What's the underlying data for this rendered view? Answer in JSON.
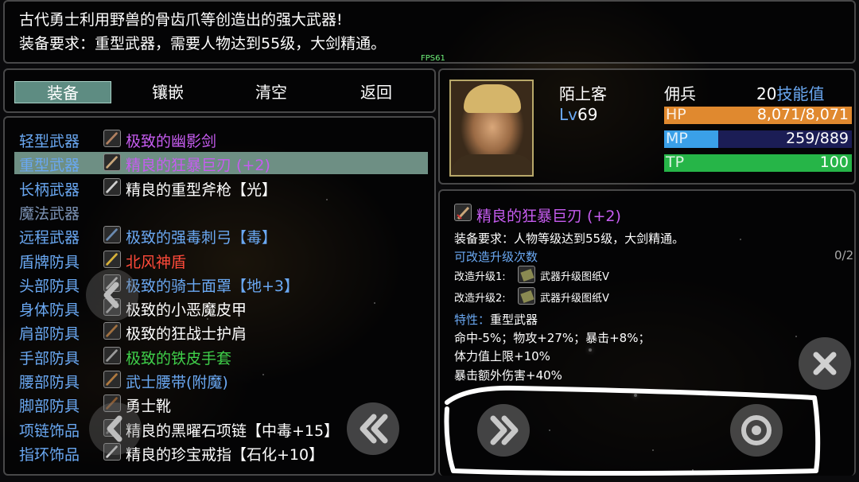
{
  "description": {
    "line1": "古代勇士利用野兽的骨齿爪等创造出的强大武器!",
    "line2": "装备要求：重型武器，需要人物达到55级，大剑精通。"
  },
  "fps": "FPS61",
  "tabs": [
    {
      "label": "装备",
      "active": true
    },
    {
      "label": "镶嵌",
      "active": false
    },
    {
      "label": "清空",
      "active": false
    },
    {
      "label": "返回",
      "active": false
    }
  ],
  "slots": [
    {
      "slot": "轻型武器",
      "item": "极致的幽影剑",
      "color": "#c65cf0",
      "icon": "sword-icon"
    },
    {
      "slot": "重型武器",
      "item": "精良的狂暴巨刃 (+2)",
      "color": "#c65cf0",
      "icon": "greatsword-icon",
      "selected": true
    },
    {
      "slot": "长柄武器",
      "item": "精良的重型斧枪【光】",
      "color": "#ffffff",
      "icon": "halberd-icon"
    },
    {
      "slot": "魔法武器",
      "item": "",
      "color": "#ffffff",
      "icon": "",
      "dim": true
    },
    {
      "slot": "远程武器",
      "item": "极致的强毒刺弓【毒】",
      "color": "#6aa8f2",
      "icon": "bow-icon"
    },
    {
      "slot": "盾牌防具",
      "item": "北风神盾",
      "color": "#ff4a3a",
      "icon": "shield-icon"
    },
    {
      "slot": "头部防具",
      "item": "极致的骑士面罩【地+3】",
      "color": "#6aa8f2",
      "icon": "helmet-icon"
    },
    {
      "slot": "身体防具",
      "item": "极致的小恶魔皮甲",
      "color": "#ffffff",
      "icon": "armor-icon"
    },
    {
      "slot": "肩部防具",
      "item": "极致的狂战士护肩",
      "color": "#ffffff",
      "icon": "pauldron-icon"
    },
    {
      "slot": "手部防具",
      "item": "极致的铁皮手套",
      "color": "#3fd04a",
      "icon": "gauntlet-icon"
    },
    {
      "slot": "腰部防具",
      "item": "武士腰带(附魔)",
      "color": "#6aa8f2",
      "icon": "belt-icon"
    },
    {
      "slot": "脚部防具",
      "item": "勇士靴",
      "color": "#ffffff",
      "icon": "boots-icon"
    },
    {
      "slot": "项链饰品",
      "item": "精良的黑曜石项链【中毒+15】",
      "color": "#ffffff",
      "icon": "necklace-icon"
    },
    {
      "slot": "指环饰品",
      "item": "精良的珍宝戒指【石化+10】",
      "color": "#ffffff",
      "icon": "ring-icon"
    }
  ],
  "hero": {
    "name": "陌上客",
    "class": "佣兵",
    "level_label": "Lv",
    "level": "69",
    "skill_points": "20",
    "skill_label": "技能值",
    "hp": {
      "label": "HP",
      "value": "8,071/8,071",
      "fraction": 1.0,
      "color": "#e0892f"
    },
    "mp": {
      "label": "MP",
      "value": "259/889",
      "fraction": 0.29,
      "color": "#3aa0e8"
    },
    "tp": {
      "label": "TP",
      "value": "100",
      "fraction": 1.0,
      "color": "#26b548"
    }
  },
  "detail": {
    "item_name": "精良的狂暴巨刃 (+2)",
    "requirement": "装备要求：人物等级达到55级，大剑精通。",
    "upgrade_label": "可改造升级次数",
    "upgrade_count": "0/2",
    "upgrade1_label": "改造升级1:",
    "upgrade1_item": "武器升级图纸V",
    "upgrade2_label": "改造升级2:",
    "upgrade2_item": "武器升级图纸V",
    "trait_label": "特性：",
    "trait_value": "重型武器",
    "stat1": "命中-5%；物攻+27%；暴击+8%；",
    "stat2": "体力值上限+10%",
    "stat3": "暴击额外伤害+40%"
  }
}
